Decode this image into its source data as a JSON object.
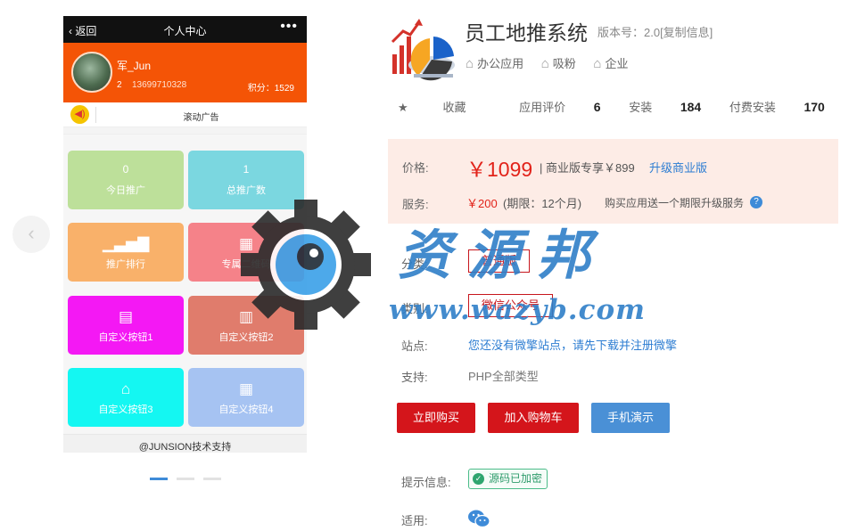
{
  "gallery": {
    "prev_icon": "chevron-left-icon",
    "phone": {
      "back_label": "返回",
      "title": "个人中心",
      "more_icon": "more-dots-icon",
      "profile": {
        "name": "军_Jun",
        "level": "2",
        "phone": "13699710328",
        "points": "积分：1529"
      },
      "ad": {
        "icon": "speaker-icon",
        "text": "滚动广告"
      },
      "tiles": [
        {
          "top": "0",
          "label": "今日推广",
          "color": "#bde09a"
        },
        {
          "top": "1",
          "label": "总推广数",
          "color": "#7bd7e0"
        },
        {
          "icon": "bar-chart-icon",
          "label": "推广排行",
          "color": "#f9b16a"
        },
        {
          "icon": "qr-code-icon",
          "label": "专属二维码",
          "color": "#f58289"
        },
        {
          "icon": "book-icon",
          "label": "自定义按钮1",
          "color": "#f418f4"
        },
        {
          "icon": "building-icon",
          "label": "自定义按钮2",
          "color": "#e07c6c"
        },
        {
          "icon": "bank-icon",
          "label": "自定义按钮3",
          "color": "#14f7f2"
        },
        {
          "icon": "calendar-icon",
          "label": "自定义按钮4",
          "color": "#a6c3f2"
        }
      ],
      "footer": "@JUNSION技术支持"
    },
    "slides_count": 3,
    "active_slide": 1
  },
  "watermark": {
    "text": "资源邦",
    "url": "www.wazyb.com"
  },
  "product": {
    "icon": "app-chart-icon",
    "title": "员工地推系统",
    "version": "版本号：2.0[复制信息]",
    "tags": [
      "办公应用",
      "吸粉",
      "企业"
    ],
    "stats": {
      "favorite": "收藏",
      "rating_label": "应用评价",
      "rating": "6",
      "install_label": "安装",
      "install": "184",
      "paid_label": "付费安装",
      "paid": "170"
    },
    "price": {
      "label": "价格:",
      "main": "￥1099",
      "pro": "| 商业版专享￥899",
      "upgrade": "升级商业版",
      "service_label": "服务:",
      "service_price": "￥200",
      "service_term": "(期限：12个月)",
      "service_note": "购买应用送一个期限升级服务"
    },
    "category_label": "分类:",
    "category": "普通版",
    "type_label": "类别:",
    "type": "微信公众号",
    "site_label": "站点:",
    "site_text": "您还没有微擎站点，请先下载并注册微擎",
    "support_label": "支持:",
    "support": "PHP全部类型",
    "buttons": {
      "buy": "立即购买",
      "cart": "加入购物车",
      "demo": "手机演示"
    },
    "tip_label": "提示信息:",
    "tip": "源码已加密",
    "apply_label": "适用:",
    "apply_icon": "wechat-icon",
    "colors": {
      "accent_red": "#d4151b",
      "link_blue": "#2d7dd2",
      "price_bg": "#fdece6"
    }
  }
}
